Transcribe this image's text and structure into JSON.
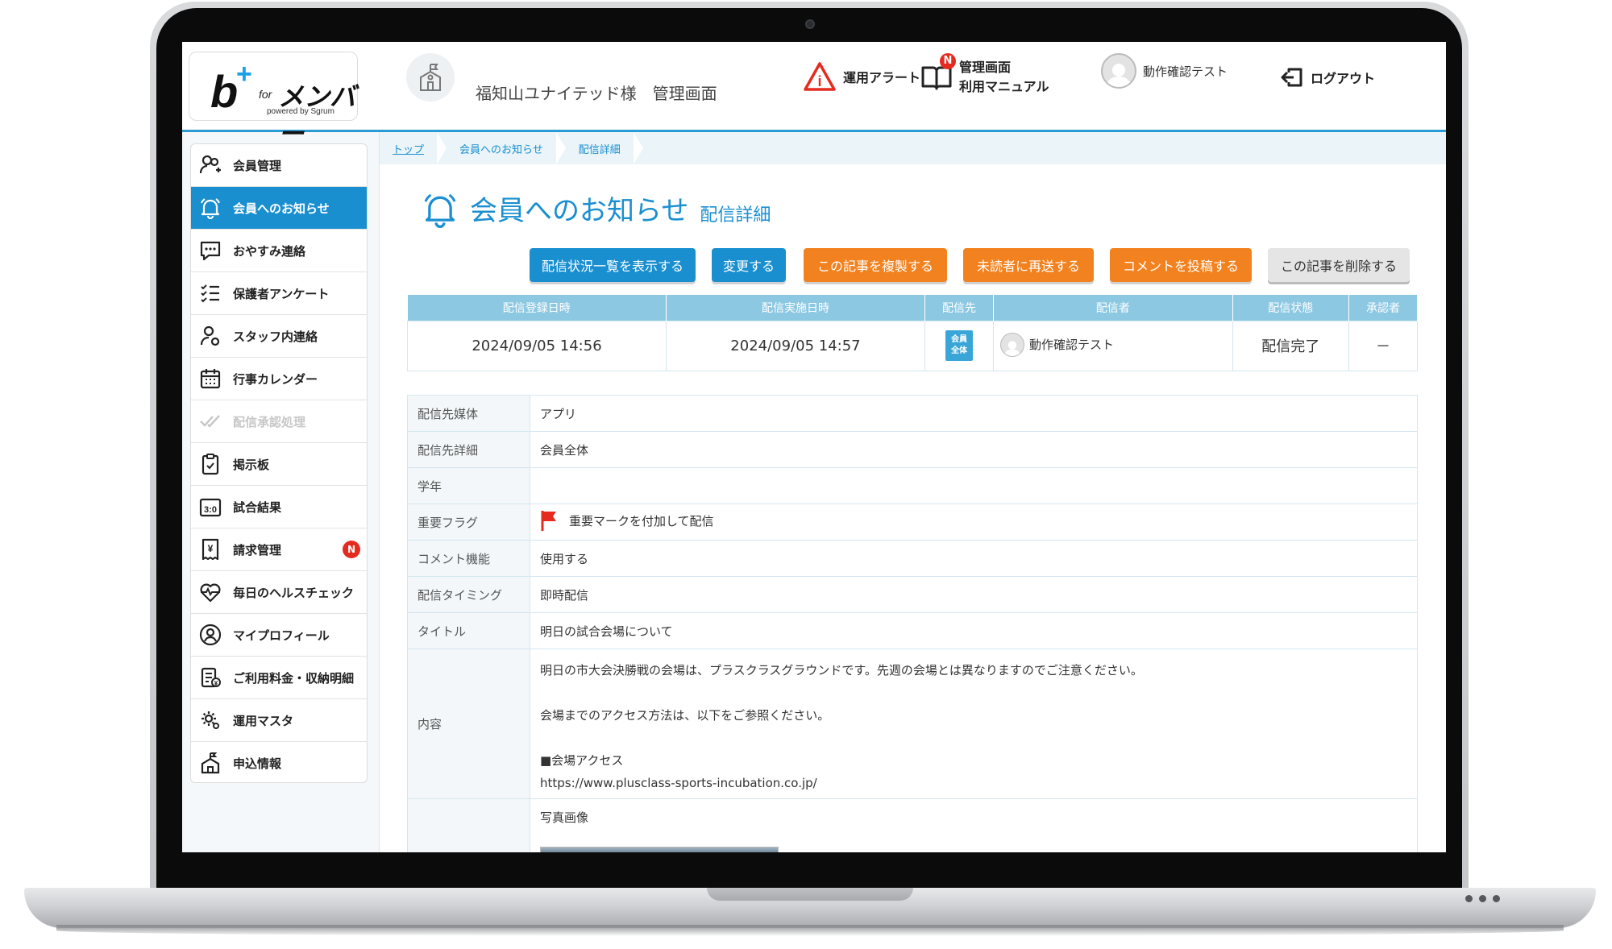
{
  "header": {
    "logo": {
      "b": "b",
      "plus": "+",
      "for": "for",
      "member": "メンバー",
      "powered": "powered by Sgrum"
    },
    "org_name": "福知山ユナイテッド様　管理画面",
    "alert_label": "運用アラート",
    "manual_line1": "管理画面",
    "manual_line2": "利用マニュアル",
    "manual_badge": "N",
    "user_name": "動作確認テスト",
    "logout_label": "ログアウト"
  },
  "sidebar": {
    "items": [
      {
        "label": "会員管理",
        "icon": "members-icon"
      },
      {
        "label": "会員へのお知らせ",
        "icon": "bell-icon"
      },
      {
        "label": "おやすみ連絡",
        "icon": "chat-icon"
      },
      {
        "label": "保護者アンケート",
        "icon": "checklist-icon"
      },
      {
        "label": "スタッフ内連絡",
        "icon": "staff-icon"
      },
      {
        "label": "行事カレンダー",
        "icon": "calendar-icon"
      },
      {
        "label": "配信承認処理",
        "icon": "double-check-icon"
      },
      {
        "label": "掲示板",
        "icon": "clipboard-icon"
      },
      {
        "label": "試合結果",
        "icon": "scoreboard-icon"
      },
      {
        "label": "請求管理",
        "icon": "invoice-icon",
        "badge": "N"
      },
      {
        "label": "毎日のヘルスチェック",
        "icon": "heart-icon"
      },
      {
        "label": "マイプロフィール",
        "icon": "profile-icon"
      },
      {
        "label": "ご利用料金・収納明細",
        "icon": "receipt-icon"
      },
      {
        "label": "運用マスタ",
        "icon": "gear-icon"
      },
      {
        "label": "申込情報",
        "icon": "school-icon"
      }
    ]
  },
  "breadcrumb": [
    "トップ",
    "会員へのお知らせ",
    "配信詳細"
  ],
  "page": {
    "title": "会員へのお知らせ",
    "subtitle": "配信詳細"
  },
  "actions": {
    "status_list": "配信状況一覧を表示する",
    "edit": "変更する",
    "duplicate": "この記事を複製する",
    "resend": "未読者に再送する",
    "comment": "コメントを投稿する",
    "delete": "この記事を削除する"
  },
  "summary": {
    "headers": [
      "配信登録日時",
      "配信実施日時",
      "配信先",
      "配信者",
      "配信状態",
      "承認者"
    ],
    "registered": "2024/09/05 14:56",
    "sent": "2024/09/05 14:57",
    "target_tag_line1": "会員",
    "target_tag_line2": "全体",
    "sender": "動作確認テスト",
    "status": "配信完了",
    "approver": "－"
  },
  "details": {
    "media_label": "配信先媒体",
    "media": "アプリ",
    "target_label": "配信先詳細",
    "target": "会員全体",
    "grade_label": "学年",
    "grade": "",
    "flag_label": "重要フラグ",
    "flag": "重要マークを付加して配信",
    "comment_label": "コメント機能",
    "comment": "使用する",
    "timing_label": "配信タイミング",
    "timing": "即時配信",
    "title_label": "タイトル",
    "title": "明日の試合会場について",
    "content_label": "内容",
    "content_line1": "明日の市大会決勝戦の会場は、プラスクラスグラウンドです。先週の会場とは異なりますのでご注意ください。",
    "content_line2": "会場までのアクセス方法は、以下をご参照ください。",
    "content_line3": "■会場アクセス",
    "content_line4": "https://www.plusclass-sports-incubation.co.jp/",
    "photo_label": "写真画像"
  },
  "colors": {
    "accent": "#1a8fd0",
    "orange": "#f2821f",
    "table_header": "#8dc8e2",
    "badge": "#e52b20"
  }
}
